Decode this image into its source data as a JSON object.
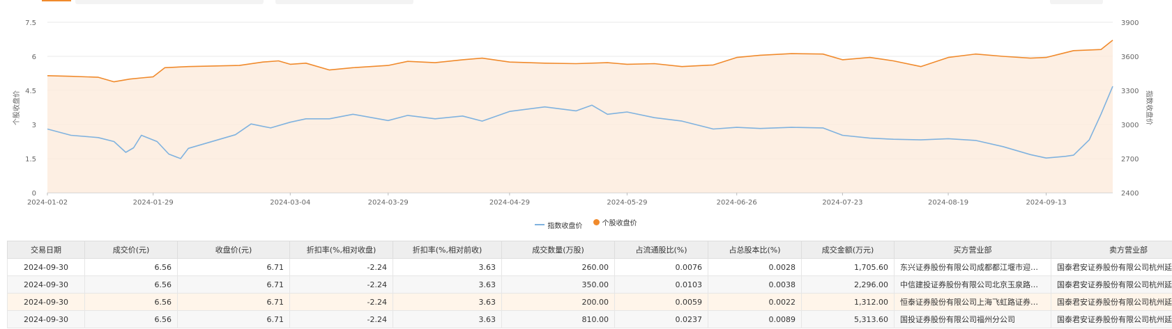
{
  "colors": {
    "index_line": "#7fb2df",
    "stock_line": "#f08a2c",
    "stock_area": "#fdebdc",
    "accent": "#f08a2c"
  },
  "chart_data": {
    "type": "line",
    "x_ticks": [
      "2024-01-02",
      "2024-01-29",
      "2024-03-04",
      "2024-03-29",
      "2024-04-29",
      "2024-05-29",
      "2024-06-26",
      "2024-07-23",
      "2024-08-19",
      "2024-09-13"
    ],
    "x_end": "2024-09-30",
    "left_axis": {
      "label": "个股收盘价",
      "ylim": [
        0,
        7.5
      ],
      "ticks": [
        "0",
        "1.5",
        "3",
        "4.5",
        "6",
        "7.5"
      ]
    },
    "right_axis": {
      "label": "指数收盘价",
      "ylim": [
        2400,
        3900
      ],
      "ticks": [
        "2400",
        "2700",
        "3000",
        "3300",
        "3600",
        "3900"
      ]
    },
    "series": [
      {
        "name": "个股收盘价",
        "axis": "left",
        "area": true,
        "points": [
          [
            "2024-01-02",
            5.15
          ],
          [
            "2024-01-08",
            5.12
          ],
          [
            "2024-01-15",
            5.08
          ],
          [
            "2024-01-19",
            4.88
          ],
          [
            "2024-01-23",
            5.0
          ],
          [
            "2024-01-26",
            5.05
          ],
          [
            "2024-01-29",
            5.1
          ],
          [
            "2024-02-01",
            5.5
          ],
          [
            "2024-02-07",
            5.55
          ],
          [
            "2024-02-20",
            5.6
          ],
          [
            "2024-02-26",
            5.75
          ],
          [
            "2024-03-01",
            5.8
          ],
          [
            "2024-03-04",
            5.65
          ],
          [
            "2024-03-08",
            5.7
          ],
          [
            "2024-03-14",
            5.4
          ],
          [
            "2024-03-20",
            5.5
          ],
          [
            "2024-03-29",
            5.6
          ],
          [
            "2024-04-03",
            5.78
          ],
          [
            "2024-04-10",
            5.72
          ],
          [
            "2024-04-17",
            5.85
          ],
          [
            "2024-04-22",
            5.92
          ],
          [
            "2024-04-29",
            5.75
          ],
          [
            "2024-05-08",
            5.7
          ],
          [
            "2024-05-16",
            5.68
          ],
          [
            "2024-05-24",
            5.72
          ],
          [
            "2024-05-29",
            5.65
          ],
          [
            "2024-06-05",
            5.68
          ],
          [
            "2024-06-12",
            5.55
          ],
          [
            "2024-06-20",
            5.62
          ],
          [
            "2024-06-26",
            5.95
          ],
          [
            "2024-07-02",
            6.05
          ],
          [
            "2024-07-10",
            6.12
          ],
          [
            "2024-07-18",
            6.1
          ],
          [
            "2024-07-23",
            5.85
          ],
          [
            "2024-07-30",
            5.95
          ],
          [
            "2024-08-05",
            5.8
          ],
          [
            "2024-08-12",
            5.55
          ],
          [
            "2024-08-19",
            5.95
          ],
          [
            "2024-08-26",
            6.1
          ],
          [
            "2024-09-02",
            6.0
          ],
          [
            "2024-09-09",
            5.92
          ],
          [
            "2024-09-13",
            5.95
          ],
          [
            "2024-09-20",
            6.25
          ],
          [
            "2024-09-27",
            6.3
          ],
          [
            "2024-09-30",
            6.71
          ]
        ]
      },
      {
        "name": "指数收盘价",
        "axis": "right",
        "area": false,
        "points": [
          [
            "2024-01-02",
            2960
          ],
          [
            "2024-01-08",
            2905
          ],
          [
            "2024-01-15",
            2885
          ],
          [
            "2024-01-19",
            2850
          ],
          [
            "2024-01-22",
            2755
          ],
          [
            "2024-01-24",
            2795
          ],
          [
            "2024-01-26",
            2905
          ],
          [
            "2024-01-30",
            2850
          ],
          [
            "2024-02-02",
            2740
          ],
          [
            "2024-02-05",
            2700
          ],
          [
            "2024-02-07",
            2790
          ],
          [
            "2024-02-19",
            2910
          ],
          [
            "2024-02-23",
            3005
          ],
          [
            "2024-02-28",
            2970
          ],
          [
            "2024-03-04",
            3020
          ],
          [
            "2024-03-08",
            3050
          ],
          [
            "2024-03-14",
            3050
          ],
          [
            "2024-03-20",
            3090
          ],
          [
            "2024-03-29",
            3035
          ],
          [
            "2024-04-03",
            3080
          ],
          [
            "2024-04-10",
            3050
          ],
          [
            "2024-04-17",
            3075
          ],
          [
            "2024-04-22",
            3030
          ],
          [
            "2024-04-29",
            3115
          ],
          [
            "2024-05-08",
            3155
          ],
          [
            "2024-05-16",
            3120
          ],
          [
            "2024-05-20",
            3170
          ],
          [
            "2024-05-24",
            3090
          ],
          [
            "2024-05-29",
            3110
          ],
          [
            "2024-06-05",
            3060
          ],
          [
            "2024-06-12",
            3030
          ],
          [
            "2024-06-20",
            2960
          ],
          [
            "2024-06-26",
            2975
          ],
          [
            "2024-07-02",
            2965
          ],
          [
            "2024-07-10",
            2975
          ],
          [
            "2024-07-18",
            2970
          ],
          [
            "2024-07-23",
            2905
          ],
          [
            "2024-07-30",
            2880
          ],
          [
            "2024-08-05",
            2870
          ],
          [
            "2024-08-12",
            2865
          ],
          [
            "2024-08-19",
            2875
          ],
          [
            "2024-08-26",
            2860
          ],
          [
            "2024-09-02",
            2805
          ],
          [
            "2024-09-09",
            2735
          ],
          [
            "2024-09-13",
            2705
          ],
          [
            "2024-09-18",
            2720
          ],
          [
            "2024-09-20",
            2730
          ],
          [
            "2024-09-24",
            2865
          ],
          [
            "2024-09-27",
            3090
          ],
          [
            "2024-09-30",
            3336
          ]
        ]
      }
    ]
  },
  "legend": [
    {
      "label": "指数收盘价",
      "kind": "line",
      "color": "#7fb2df"
    },
    {
      "label": "个股收盘价",
      "kind": "dot",
      "color": "#f08a2c"
    }
  ],
  "table": {
    "headers": [
      "交易日期",
      "成交价(元)",
      "收盘价(元)",
      "折扣率(%,相对收盘)",
      "折扣率(%,相对前收)",
      "成交数量(万股)",
      "占流通股比(%)",
      "占总股本比(%)",
      "成交金额(万元)",
      "买方营业部",
      "卖方营业部"
    ],
    "rows": [
      [
        "2024-09-30",
        "6.56",
        "6.71",
        "-2.24",
        "3.63",
        "260.00",
        "0.0076",
        "0.0028",
        "1,705.60",
        "东兴证券股份有限公司成都都江堰市迎宾大道证券营业部",
        "国泰君安证券股份有限公司杭州延安路证券营业部"
      ],
      [
        "2024-09-30",
        "6.56",
        "6.71",
        "-2.24",
        "3.63",
        "350.00",
        "0.0103",
        "0.0038",
        "2,296.00",
        "中信建投证券股份有限公司北京玉泉路证券营业部",
        "国泰君安证券股份有限公司杭州延安路证券营业部"
      ],
      [
        "2024-09-30",
        "6.56",
        "6.71",
        "-2.24",
        "3.63",
        "200.00",
        "0.0059",
        "0.0022",
        "1,312.00",
        "恒泰证券股份有限公司上海飞虹路证券营业部",
        "国泰君安证券股份有限公司杭州延安路证券营业部"
      ],
      [
        "2024-09-30",
        "6.56",
        "6.71",
        "-2.24",
        "3.63",
        "810.00",
        "0.0237",
        "0.0089",
        "5,313.60",
        "国投证券股份有限公司福州分公司",
        "国泰君安证券股份有限公司杭州延安路证券营业部"
      ]
    ]
  }
}
